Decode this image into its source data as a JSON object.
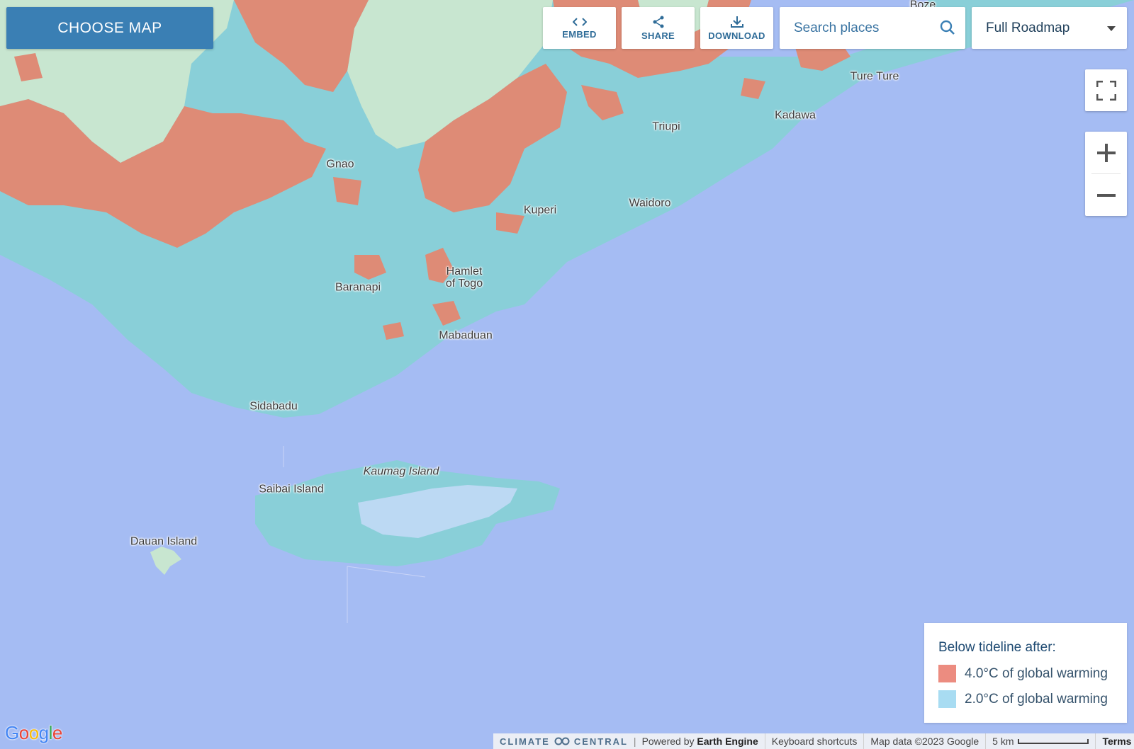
{
  "toolbar": {
    "choose_map": "CHOOSE MAP",
    "embed": "EMBED",
    "share": "SHARE",
    "download": "DOWNLOAD",
    "search_placeholder": "Search places",
    "map_type": "Full Roadmap"
  },
  "places": {
    "boze": "Boze",
    "ture_ture": "Ture Ture",
    "kadawa": "Kadawa",
    "triupi": "Triupi",
    "gnao": "Gnao",
    "kuperi": "Kuperi",
    "waidoro": "Waidoro",
    "hamlet_line1": "Hamlet",
    "hamlet_line2": "of Togo",
    "baranapi": "Baranapi",
    "mabaduan": "Mabaduan",
    "sidabadu": "Sidabadu",
    "kaumag": "Kaumag Island",
    "saibai": "Saibai Island",
    "dauan": "Dauan Island"
  },
  "legend": {
    "title": "Below tideline after:",
    "items": [
      {
        "label": "4.0°C of global warming",
        "color": "#ec8c80"
      },
      {
        "label": "2.0°C of global warming",
        "color": "#a8dcf2"
      }
    ]
  },
  "footer": {
    "brand_left": "CLIMATE",
    "brand_right": "CENTRAL",
    "powered_by": "Powered by",
    "earth_engine": "Earth Engine",
    "shortcuts": "Keyboard shortcuts",
    "map_data": "Map data ©2023 Google",
    "scale": "5 km",
    "terms": "Terms"
  },
  "google_logo": "Google",
  "colors": {
    "sea": "#a5bcf3",
    "land": "#c8e6d0",
    "flood_2c": "#89cfd8",
    "flood_4c": "#de8b76"
  },
  "icons": {
    "embed": "code-icon",
    "share": "share-icon",
    "download": "download-icon",
    "search": "search-icon",
    "fullscreen": "fullscreen-icon",
    "zoom_in": "plus-icon",
    "zoom_out": "minus-icon"
  }
}
